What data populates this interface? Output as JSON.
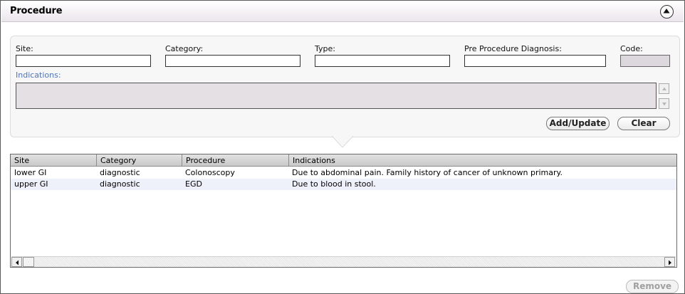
{
  "panel": {
    "title": "Procedure"
  },
  "form": {
    "site": {
      "label": "Site:",
      "value": ""
    },
    "category": {
      "label": "Category:",
      "value": ""
    },
    "type": {
      "label": "Type:",
      "value": ""
    },
    "pre_diagnosis": {
      "label": "Pre Procedure Diagnosis:",
      "value": ""
    },
    "code": {
      "label": "Code:",
      "value": ""
    },
    "indications": {
      "label": "Indications:",
      "value": ""
    },
    "add_update_label": "Add/Update",
    "clear_label": "Clear"
  },
  "grid": {
    "columns": [
      "Site",
      "Category",
      "Procedure",
      "Indications"
    ],
    "rows": [
      [
        "lower GI",
        "diagnostic",
        "Colonoscopy",
        "Due to abdominal pain. Family history of cancer of unknown primary."
      ],
      [
        "upper GI",
        "diagnostic",
        "EGD",
        "Due to blood in stool."
      ]
    ]
  },
  "remove_label": "Remove",
  "icons": {
    "collapse": "chevron-up-circle-icon",
    "scroll_up": "arrow-up-icon",
    "scroll_down": "arrow-down-icon",
    "scroll_left": "arrow-left-icon",
    "scroll_right": "arrow-right-icon"
  },
  "colors": {
    "indications_label": "#4a73c9",
    "row_highlight": "#eef1fa",
    "disabled_field": "#ddd8dd"
  }
}
